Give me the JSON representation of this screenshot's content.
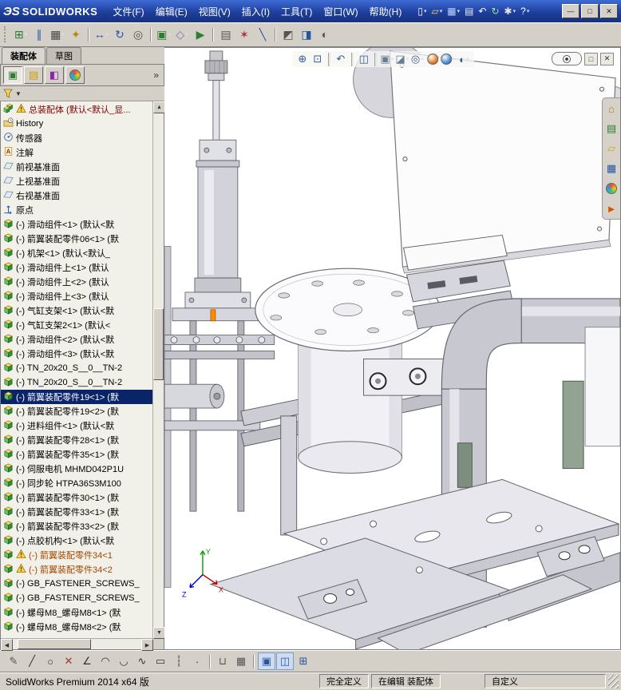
{
  "app": {
    "logo_mark": "ЭS",
    "logo_text": "SOLIDWORKS"
  },
  "colors": {
    "selection": "#0a246a",
    "titlebar_top": "#3d6bd4",
    "titlebar_bottom": "#16307c",
    "tree_background": "#f1f0e9",
    "viewport_background": "#ffffff",
    "highlight_orange": "#ff8a00"
  },
  "titlebar": {
    "menus": [
      {
        "key": "file",
        "label": "文件(F)"
      },
      {
        "key": "edit",
        "label": "编辑(E)"
      },
      {
        "key": "view",
        "label": "视图(V)"
      },
      {
        "key": "insert",
        "label": "插入(I)"
      },
      {
        "key": "tools",
        "label": "工具(T)"
      },
      {
        "key": "window",
        "label": "窗口(W)"
      },
      {
        "key": "help",
        "label": "帮助(H)"
      }
    ],
    "quick_icons": [
      {
        "name": "new-document-icon",
        "glyph": "▯",
        "fg": "#ffffff",
        "dd": true
      },
      {
        "name": "open-document-icon",
        "glyph": "▱",
        "fg": "#ffd95e",
        "dd": true
      },
      {
        "name": "save-icon",
        "glyph": "▦",
        "fg": "#bcd2ff",
        "dd": true
      },
      {
        "name": "print-icon",
        "glyph": "▤",
        "fg": "#e4e9f5"
      },
      {
        "name": "undo-icon",
        "glyph": "↶",
        "fg": "#ffffff"
      },
      {
        "name": "rebuild-icon",
        "glyph": "↻",
        "fg": "#9fe29f"
      },
      {
        "name": "options-icon",
        "glyph": "✱",
        "fg": "#e8e8e8",
        "dd": true
      },
      {
        "name": "help-icon",
        "glyph": "?",
        "fg": "#ffffff",
        "dd": true
      }
    ],
    "window_buttons": [
      {
        "name": "minimize-button",
        "glyph": "—",
        "fg": "#222222"
      },
      {
        "name": "maximize-button",
        "glyph": "□",
        "fg": "#222222"
      },
      {
        "name": "close-button",
        "glyph": "✕",
        "fg": "#222222"
      }
    ]
  },
  "toolbar": {
    "icons": [
      {
        "name": "insert-components-icon",
        "glyph": "⊞",
        "fg": "#2e7d32",
        "dd": true
      },
      {
        "name": "mate-icon",
        "glyph": "∥",
        "fg": "#2456a8"
      },
      {
        "name": "linear-component-pattern-icon",
        "glyph": "▦",
        "fg": "#444444",
        "dd": true
      },
      {
        "name": "smart-fasteners-icon",
        "glyph": "✦",
        "fg": "#b8860b"
      },
      {
        "sep": true
      },
      {
        "name": "move-component-icon",
        "glyph": "↔",
        "fg": "#2456a8",
        "dd": true
      },
      {
        "name": "rotate-component-icon",
        "glyph": "↻",
        "fg": "#2456a8"
      },
      {
        "name": "show-hidden-components-icon",
        "glyph": "◎",
        "fg": "#555555"
      },
      {
        "sep": true
      },
      {
        "name": "assembly-features-icon",
        "glyph": "▣",
        "fg": "#2e7d32",
        "dd": true
      },
      {
        "name": "reference-geometry-icon",
        "glyph": "◇",
        "fg": "#7d6fb0",
        "dd": true
      },
      {
        "name": "new-motion-study-icon",
        "glyph": "▶",
        "fg": "#2e7d32"
      },
      {
        "sep": true
      },
      {
        "name": "bill-of-materials-icon",
        "glyph": "▤",
        "fg": "#555555"
      },
      {
        "name": "exploded-view-icon",
        "glyph": "✶",
        "fg": "#b03030"
      },
      {
        "name": "explode-line-sketch-icon",
        "glyph": "╲",
        "fg": "#2456a8"
      },
      {
        "sep": true
      },
      {
        "name": "interference-detection-icon",
        "glyph": "◩",
        "fg": "#555555"
      },
      {
        "name": "assembly-visualization-icon",
        "glyph": "◨",
        "fg": "#2456a8"
      },
      {
        "name": "performance-evaluation-icon",
        "glyph": "◐",
        "fg": "#555555"
      }
    ]
  },
  "left_panel": {
    "tabs": [
      {
        "key": "assembly",
        "label": "装配体",
        "active": true
      },
      {
        "key": "sketch",
        "label": "草图",
        "active": false
      }
    ],
    "manager_tabs": [
      {
        "name": "featuremanager-design-tree-tab",
        "glyph": "▣",
        "fg": "#2e7d32",
        "on": true
      },
      {
        "name": "propertymanager-tab",
        "glyph": "▤",
        "fg": "#caa002"
      },
      {
        "name": "configurationmanager-tab",
        "glyph": "◧",
        "fg": "#8e24aa"
      },
      {
        "name": "displaymanager-tab",
        "kind": "circle",
        "bg": "conic-gradient(#e74c3c,#f1c40f,#2ecc71,#3498db,#e74c3c)"
      }
    ],
    "overflow_chevron": "»",
    "tree": {
      "items": [
        {
          "t": "asm",
          "w": 1,
          "c": "#7d0000",
          "label": "总装配体 (默认<默认_显..."
        },
        {
          "t": "hist",
          "label": "History"
        },
        {
          "t": "sensor",
          "label": "传感器"
        },
        {
          "t": "note",
          "label": "注解"
        },
        {
          "t": "plane",
          "label": "前视基准面"
        },
        {
          "t": "plane",
          "label": "上视基准面"
        },
        {
          "t": "plane",
          "label": "右视基准面"
        },
        {
          "t": "origin",
          "label": "原点"
        },
        {
          "t": "comp",
          "label": "(-) 滑动组件<1> (默认<默"
        },
        {
          "t": "comp",
          "label": "(-) 箭翼装配零件06<1> (默"
        },
        {
          "t": "comp",
          "label": "(-) 机架<1> (默认<默认_"
        },
        {
          "t": "comp",
          "label": "(-) 滑动组件上<1> (默认"
        },
        {
          "t": "comp",
          "label": "(-) 滑动组件上<2> (默认"
        },
        {
          "t": "comp",
          "label": "(-) 滑动组件上<3> (默认"
        },
        {
          "t": "comp",
          "label": "(-) 气缸支架<1> (默认<默"
        },
        {
          "t": "comp",
          "label": "(-) 气缸支架2<1> (默认<"
        },
        {
          "t": "comp",
          "label": "(-) 滑动组件<2> (默认<默"
        },
        {
          "t": "comp",
          "label": "(-) 滑动组件<3> (默认<默"
        },
        {
          "t": "comp",
          "label": "(-) TN_20x20_S__0__TN-2"
        },
        {
          "t": "comp",
          "label": "(-) TN_20x20_S__0__TN-2"
        },
        {
          "t": "comp",
          "sel": 1,
          "label": "(-) 箭翼装配零件19<1> (默"
        },
        {
          "t": "comp",
          "label": "(-) 箭翼装配零件19<2> (默"
        },
        {
          "t": "comp",
          "label": "(-) 进料组件<1> (默认<默"
        },
        {
          "t": "comp",
          "label": "(-) 箭翼装配零件28<1> (默"
        },
        {
          "t": "comp",
          "label": "(-) 箭翼装配零件35<1> (默"
        },
        {
          "t": "comp",
          "label": "(-) 伺服电机 MHMD042P1U"
        },
        {
          "t": "comp",
          "label": "(-) 同步轮 HTPA36S3M100"
        },
        {
          "t": "comp",
          "label": "(-) 箭翼装配零件30<1> (默"
        },
        {
          "t": "comp",
          "label": "(-) 箭翼装配零件33<1> (默"
        },
        {
          "t": "comp",
          "label": "(-) 箭翼装配零件33<2> (默"
        },
        {
          "t": "comp",
          "label": "(-) 点胶机构<1> (默认<默"
        },
        {
          "t": "comp",
          "w": 1,
          "c": "#a34700",
          "label": "(-) 箭翼装配零件34<1"
        },
        {
          "t": "comp",
          "w": 1,
          "c": "#a34700",
          "label": "(-) 箭翼装配零件34<2"
        },
        {
          "t": "comp",
          "label": "(-) GB_FASTENER_SCREWS_"
        },
        {
          "t": "comp",
          "label": "(-) GB_FASTENER_SCREWS_"
        },
        {
          "t": "comp",
          "label": "(-) 螺母M8_螺母M8<1> (默"
        },
        {
          "t": "comp",
          "label": "(-) 螺母M8_螺母M8<2> (默"
        }
      ]
    }
  },
  "viewport": {
    "headsup_icons": [
      {
        "name": "zoom-to-fit-icon",
        "glyph": "⊕",
        "fg": "#3c5a96"
      },
      {
        "name": "zoom-to-area-icon",
        "glyph": "⊡",
        "fg": "#3c5a96"
      },
      {
        "sep": true
      },
      {
        "name": "previous-view-icon",
        "glyph": "↶",
        "fg": "#3c5a96"
      },
      {
        "sep": true
      },
      {
        "name": "section-view-icon",
        "glyph": "◫",
        "fg": "#3c5a96"
      },
      {
        "sep": true
      },
      {
        "name": "view-orientation-icon",
        "glyph": "▣",
        "fg": "#6a7b94",
        "dd": true
      },
      {
        "name": "display-style-icon",
        "glyph": "◪",
        "fg": "#6a7b94",
        "dd": true
      },
      {
        "name": "hide-show-items-icon",
        "glyph": "◎",
        "fg": "#3c5a96",
        "dd": true
      },
      {
        "name": "edit-appearance-icon",
        "kind": "circle",
        "bg": "radial-gradient(circle at 35% 30%,#fff,#e2842c 60%,#a33c1e)"
      },
      {
        "name": "apply-scene-icon",
        "kind": "circle",
        "bg": "radial-gradient(circle at 35% 30%,#fff,#4a90d9 60%,#1c4f86)",
        "dd": true
      },
      {
        "name": "view-settings-icon",
        "glyph": "◐",
        "fg": "#3c5a96",
        "dd": true
      }
    ],
    "doc_buttons": [
      {
        "name": "restore-document-button",
        "glyph": "□",
        "fg": "#333333"
      },
      {
        "name": "close-document-button",
        "glyph": "✕",
        "fg": "#333333"
      }
    ],
    "task_pane_icons": [
      {
        "name": "solidworks-resources-icon",
        "glyph": "⌂",
        "fg": "#b4762a"
      },
      {
        "name": "design-library-icon",
        "glyph": "▤",
        "fg": "#2e7d32"
      },
      {
        "name": "file-explorer-icon",
        "glyph": "▱",
        "fg": "#d9a520"
      },
      {
        "name": "view-palette-icon",
        "glyph": "▦",
        "fg": "#2456a8"
      },
      {
        "name": "appearances-icon",
        "kind": "circle",
        "bg": "conic-gradient(#e74c3c,#f1c40f,#2ecc71,#3498db,#e74c3c)"
      },
      {
        "name": "custom-properties-icon",
        "glyph": "►",
        "fg": "#d35400"
      }
    ],
    "triad": {
      "labels": [
        "Y",
        "X",
        "Z"
      ],
      "colors": [
        "#00a000",
        "#cc0000",
        "#0000cc"
      ]
    }
  },
  "sketchbar": {
    "icons": [
      {
        "name": "sketch-icon",
        "glyph": "✎",
        "fg": "#555555"
      },
      {
        "name": "line-icon",
        "glyph": "╱",
        "fg": "#333333"
      },
      {
        "name": "circle-icon",
        "glyph": "○",
        "fg": "#333333"
      },
      {
        "name": "trim-entities-icon",
        "glyph": "✕",
        "fg": "#a03333"
      },
      {
        "name": "smart-dimension-icon",
        "glyph": "∠",
        "fg": "#333333"
      },
      {
        "name": "tangent-arc-icon",
        "glyph": "◠",
        "fg": "#333333"
      },
      {
        "name": "three-point-arc-icon",
        "glyph": "◡",
        "fg": "#333333"
      },
      {
        "name": "spline-icon",
        "glyph": "∿",
        "fg": "#333333"
      },
      {
        "name": "corner-rectangle-icon",
        "glyph": "▭",
        "fg": "#333333"
      },
      {
        "name": "centerline-icon",
        "glyph": "┆",
        "fg": "#333333"
      },
      {
        "name": "point-icon",
        "glyph": "·",
        "fg": "#333333"
      },
      {
        "sep": true
      },
      {
        "name": "sketch-snaps-icon",
        "glyph": "⊔",
        "fg": "#555555"
      },
      {
        "name": "grid-icon",
        "glyph": "▦",
        "fg": "#555555"
      },
      {
        "sep": true
      },
      {
        "name": "shaded-sketch-contours-icon",
        "glyph": "▣",
        "fg": "#2456a8",
        "on": true
      },
      {
        "name": "instant2d-icon",
        "glyph": "◫",
        "fg": "#2456a8",
        "on": true
      },
      {
        "name": "sketch-table-icon",
        "glyph": "⊞",
        "fg": "#2456a8"
      }
    ]
  },
  "statusbar": {
    "left": "SolidWorks Premium 2014 x64 版",
    "cells": [
      "完全定义",
      "在编辑 装配体",
      "自定义"
    ]
  }
}
